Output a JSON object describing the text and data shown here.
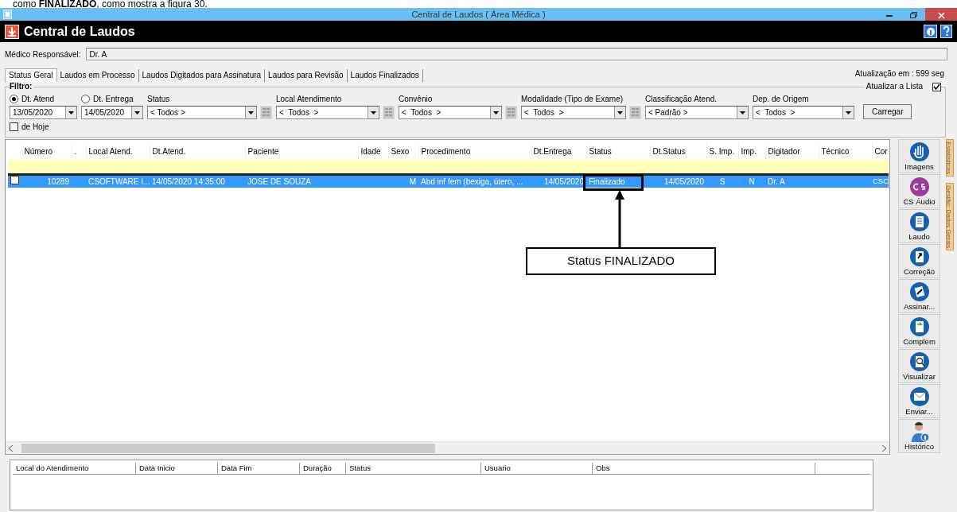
{
  "doc_caption": "como **FINALIZADO**, como mostra a figura 30.",
  "window": {
    "title": "Central de Laudos ( Área Médica )"
  },
  "header": {
    "title": "Central de Laudos"
  },
  "medico": {
    "label": "Médico Responsável:",
    "value": "Dr. A"
  },
  "tabs": [
    {
      "label": "Status Geral",
      "selected": true
    },
    {
      "label": "Laudos em Processo",
      "selected": false
    },
    {
      "label": "Laudos Digitados para Assinatura",
      "selected": false
    },
    {
      "label": "Laudos para Revisão",
      "selected": false
    },
    {
      "label": "Laudos Finalizados",
      "selected": false
    }
  ],
  "refresh_info": "Atualização em : 599 seg",
  "filter": {
    "title": "Filtro:",
    "auto_refresh": {
      "label": "Atualizar a Lista",
      "checked": true
    },
    "fields": [
      {
        "kind": "date",
        "label": "Dt. Atend",
        "selected": true,
        "value": "13/05/2020"
      },
      {
        "kind": "date",
        "label": "Dt. Entrega",
        "selected": false,
        "value": "14/05/2020"
      },
      {
        "kind": "combo",
        "label": "Status",
        "value": "< Todos >",
        "picker": true
      },
      {
        "kind": "combo",
        "label": "Local Atendimento",
        "value": "<  Todos  >",
        "picker": true
      },
      {
        "kind": "combo",
        "label": "Convênio",
        "value": "<  Todos  >",
        "picker": true
      },
      {
        "kind": "combo",
        "label": "Modalidade (Tipo de Exame)",
        "value": "<  Todos  >",
        "picker": true
      },
      {
        "kind": "combo",
        "label": "Classificação Atend.",
        "value": "< Padrão >",
        "picker": false
      },
      {
        "kind": "combo",
        "label": "Dep. de Origem",
        "value": "<  Todos  >",
        "picker": false
      }
    ],
    "de_hoje": {
      "label": "de Hoje",
      "checked": false
    },
    "load_button": "Carregar"
  },
  "grid": {
    "columns": [
      "Número",
      ".",
      "Local Atend.",
      "Dt.Atend.",
      "Paciente",
      "Idade",
      "Sexo",
      "Procedimento",
      "Dt.Entrega",
      "Status",
      "Dt.Status",
      "S. Imp.",
      "Imp.",
      "Digitador",
      "Técnico",
      "Cor"
    ],
    "rows": [
      {
        "checked": false,
        "selected": true,
        "cells": [
          "10289",
          "",
          "CSOFTWARE I...",
          "14/05/2020 14:35:00",
          "JOSE DE SOUZA",
          "",
          "M",
          "Abd inf fem (bexiga, útero, ...",
          "14/05/2020",
          "Finalizado",
          "14/05/2020",
          "S",
          "N",
          "Dr. A",
          "",
          "CSC"
        ]
      }
    ],
    "annotation": {
      "label": "Status FINALIZADO"
    }
  },
  "side_buttons": [
    {
      "label": "Imagens"
    },
    {
      "label": "CS Áudio"
    },
    {
      "label": "Laudo"
    },
    {
      "label": "Correção"
    },
    {
      "label": "Assinar..."
    },
    {
      "label": "Complem"
    },
    {
      "label": "Visualizar"
    },
    {
      "label": "Enviar..."
    },
    {
      "label": "Histórico"
    }
  ],
  "side_tabs": [
    {
      "label": "Estatísticas"
    },
    {
      "label": "Gestão: Dados Gerais"
    }
  ],
  "history_table": {
    "columns": [
      "Local do Atendimento",
      "Data Inicio",
      "Data Fim",
      "Duração",
      "Status",
      "Usuario",
      "Obs"
    ]
  }
}
